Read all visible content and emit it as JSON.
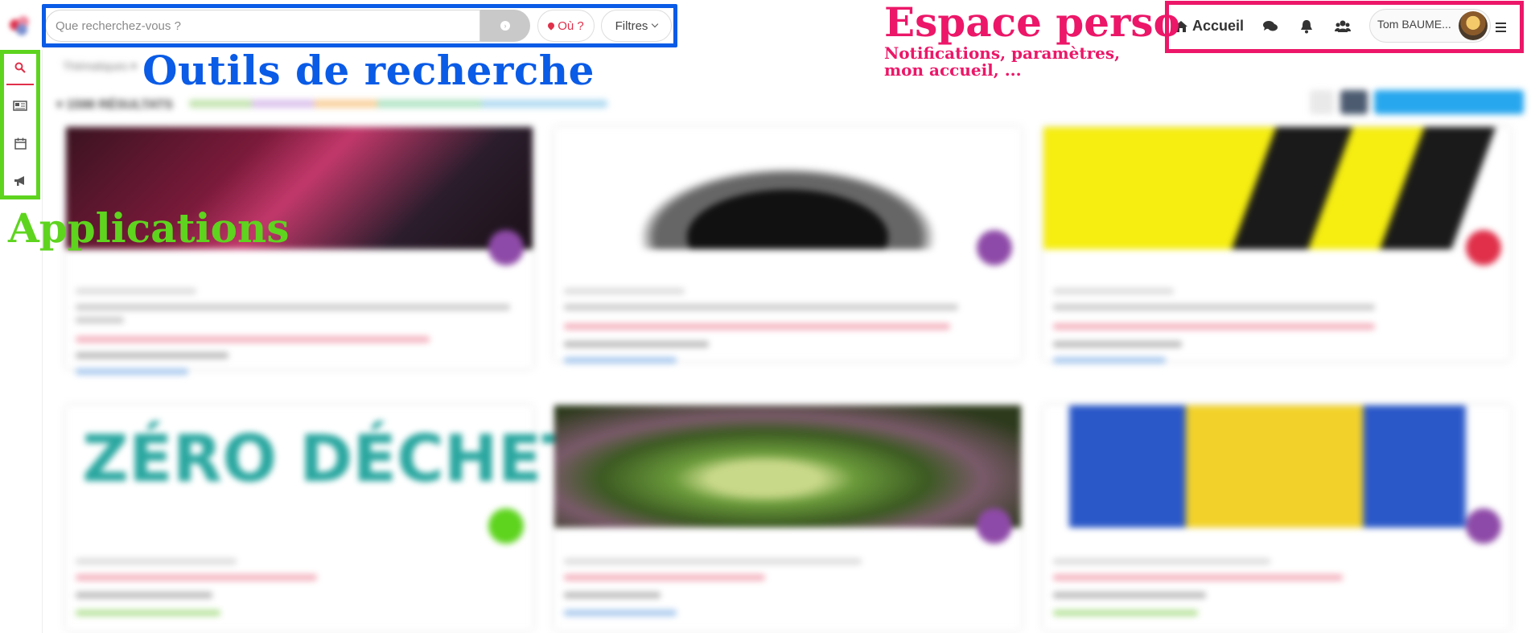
{
  "search": {
    "placeholder": "Que recherchez-vous ?",
    "where_label": "Où ?",
    "filters_label": "Filtres"
  },
  "nav": {
    "home_label": "Accueil",
    "user_name": "Tom BAUME..."
  },
  "annotations": {
    "search_tools": "Outils de recherche",
    "personal_space": "Espace perso",
    "personal_space_desc_1": "Notifications, paramètres,",
    "personal_space_desc_2": "mon accueil, ...",
    "applications": "Applications"
  },
  "sidebar": {
    "items": [
      {
        "icon": "search-icon"
      },
      {
        "icon": "newspaper-icon"
      },
      {
        "icon": "calendar-icon"
      },
      {
        "icon": "megaphone-icon"
      }
    ]
  },
  "colors": {
    "annotation_search": "#0a5be6",
    "annotation_perso": "#ec1768",
    "annotation_apps": "#5ed41e",
    "accent_red": "#e0304a"
  },
  "cards": [
    {
      "image": "red-dark-photo"
    },
    {
      "image": "black-white-mountain"
    },
    {
      "image": "yellow-black-logo"
    },
    {
      "image": "zero-dechet-logo",
      "logo_text": "ZÉRO DÉCHET"
    },
    {
      "image": "green-plant-photo"
    },
    {
      "image": "yellow-vest-photo"
    }
  ]
}
